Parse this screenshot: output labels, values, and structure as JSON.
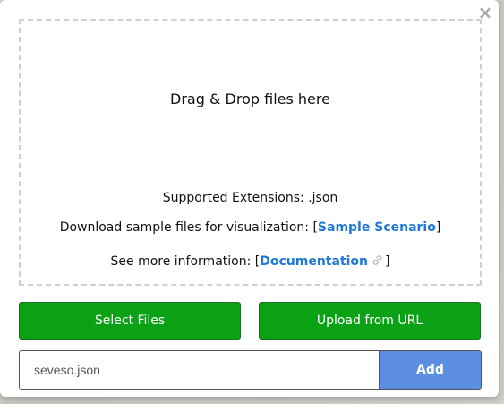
{
  "dialog": {
    "close_glyph": "×",
    "dropzone": {
      "title": "Drag & Drop files here",
      "supported_extensions": "Supported Extensions: .json",
      "sample_prefix": "Download sample files for visualization: [",
      "sample_link": "Sample Scenario",
      "sample_suffix": "]",
      "info_prefix": "See more information: [",
      "info_link": "Documentation",
      "info_icon": "link-icon",
      "info_suffix": "]"
    },
    "buttons": {
      "select_files": "Select Files",
      "upload_from_url": "Upload from URL"
    },
    "url_input": {
      "value": "seveso.json",
      "placeholder": ""
    },
    "add_button": "Add"
  },
  "colors": {
    "green_button": "#0aa115",
    "add_button": "#5b8de0",
    "link": "#1f78d8",
    "dropzone_border": "#cfcfcf"
  }
}
